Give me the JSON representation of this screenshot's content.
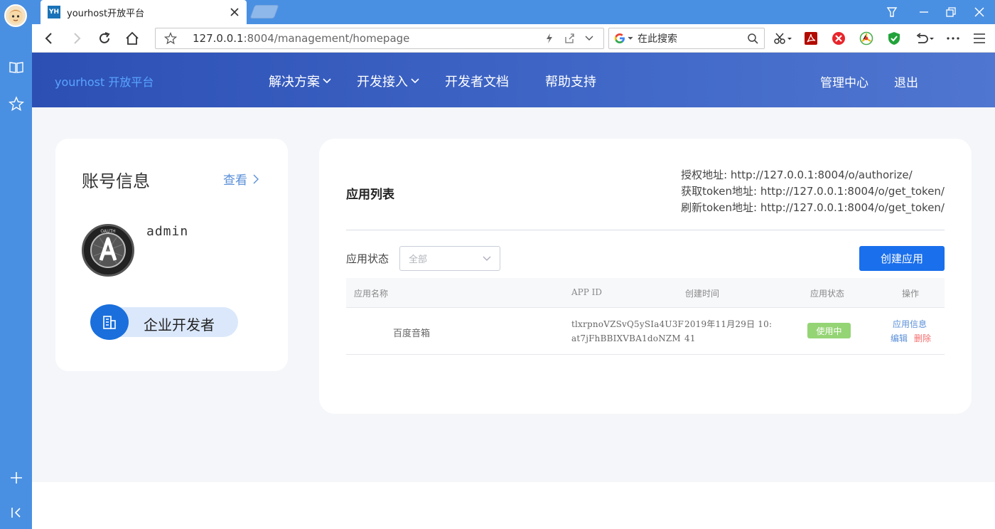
{
  "browser": {
    "tab_title": "yourhost开放平台",
    "favicon_text": "YH",
    "url_host": "127.0.0.1",
    "url_rest": ":8004/management/homepage",
    "search_placeholder": "在此搜索"
  },
  "header": {
    "brand": "yourhost 开放平台",
    "nav": [
      {
        "label": "解决方案",
        "has_dropdown": true
      },
      {
        "label": "开发接入",
        "has_dropdown": true
      },
      {
        "label": "开发者文档",
        "has_dropdown": false
      },
      {
        "label": "帮助支持",
        "has_dropdown": false
      }
    ],
    "manage_center": "管理中心",
    "logout": "退出"
  },
  "account": {
    "title": "账号信息",
    "view_link": "查看",
    "username": "admin",
    "role": "企业开发者"
  },
  "apps": {
    "title": "应用列表",
    "endpoints": [
      "授权地址: http://127.0.0.1:8004/o/authorize/",
      "获取token地址: http://127.0.0.1:8004/o/get_token/",
      "刷新token地址: http://127.0.0.1:8004/o/get_token/"
    ],
    "filter_label": "应用状态",
    "filter_value": "全部",
    "create_button": "创建应用",
    "columns": [
      "应用名称",
      "APP ID",
      "创建时间",
      "应用状态",
      "操作"
    ],
    "rows": [
      {
        "name": "百度音箱",
        "app_id_line1": "tlxrpnoVZSvQ5ySIa4U3F",
        "app_id_line2": "at7jFhBBIXVBA1doNZM",
        "created_line1": "2019年11月29日 10:",
        "created_line2": "41",
        "status": "使用中",
        "op_info": "应用信息",
        "op_edit": "编辑",
        "op_delete": "删除"
      }
    ]
  },
  "colors": {
    "header_start": "#2c4fb4",
    "header_end": "#4f76d0",
    "primary": "#1a6fec",
    "status_active": "#95d475",
    "delete_red": "#f56c6c",
    "link_blue": "#5a8fd8"
  }
}
